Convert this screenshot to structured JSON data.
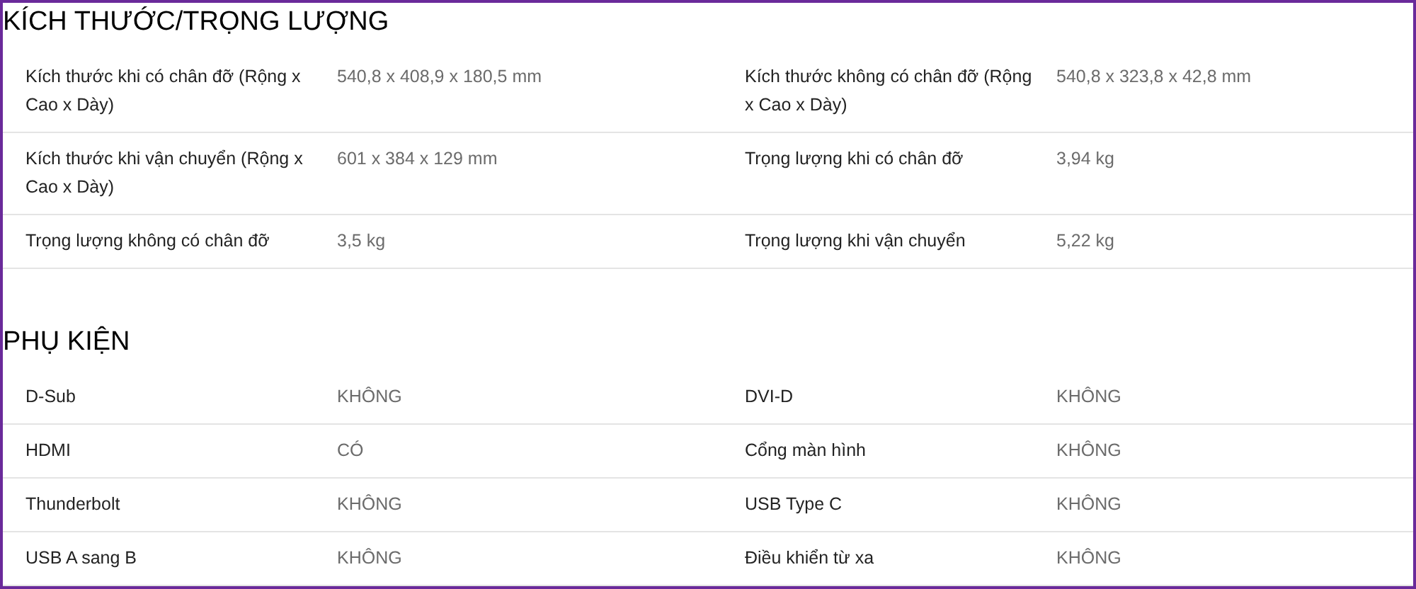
{
  "sections": [
    {
      "title": "KÍCH THƯỚC/TRỌNG LƯỢNG",
      "rows": [
        [
          {
            "label": "Kích thước khi có chân đỡ (Rộng x Cao x Dày)",
            "value": "540,8 x 408,9 x 180,5 mm"
          },
          {
            "label": "Kích thước không có chân đỡ (Rộng x Cao x Dày)",
            "value": "540,8 x 323,8 x 42,8 mm"
          }
        ],
        [
          {
            "label": "Kích thước khi vận chuyển (Rộng x Cao x Dày)",
            "value": "601 x 384 x 129 mm"
          },
          {
            "label": "Trọng lượng khi có chân đỡ",
            "value": "3,94 kg"
          }
        ],
        [
          {
            "label": "Trọng lượng không có chân đỡ",
            "value": "3,5 kg"
          },
          {
            "label": "Trọng lượng khi vận chuyển",
            "value": "5,22 kg"
          }
        ]
      ]
    },
    {
      "title": "PHỤ KIỆN",
      "rows": [
        [
          {
            "label": "D-Sub",
            "value": "KHÔNG"
          },
          {
            "label": "DVI-D",
            "value": "KHÔNG"
          }
        ],
        [
          {
            "label": "HDMI",
            "value": "CÓ"
          },
          {
            "label": "Cổng màn hình",
            "value": "KHÔNG"
          }
        ],
        [
          {
            "label": "Thunderbolt",
            "value": "KHÔNG"
          },
          {
            "label": "USB Type C",
            "value": "KHÔNG"
          }
        ],
        [
          {
            "label": "USB A sang B",
            "value": "KHÔNG"
          },
          {
            "label": "Điều khiển từ xa",
            "value": "KHÔNG"
          }
        ]
      ]
    }
  ]
}
